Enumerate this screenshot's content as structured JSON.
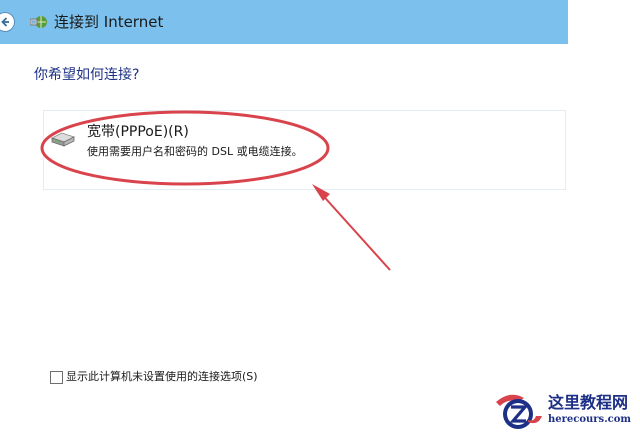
{
  "window": {
    "title": "连接到 Internet"
  },
  "main": {
    "question": "你希望如何连接?",
    "option": {
      "title": "宽带(PPPoE)(R)",
      "description": "使用需要用户名和密码的 DSL 或电缆连接。",
      "icon": "network-modem-icon"
    },
    "checkbox": {
      "label": "显示此计算机未设置使用的连接选项(S)",
      "checked": false
    }
  },
  "annotation": {
    "color": "#d9434c",
    "shapes": [
      "ellipse",
      "arrow"
    ]
  },
  "watermark": {
    "name": "这里教程网",
    "url": "herecours.com"
  },
  "colors": {
    "title_bar": "#7cc1ee",
    "question_text": "#1e3287",
    "watermark_text": "#1d2f86"
  }
}
